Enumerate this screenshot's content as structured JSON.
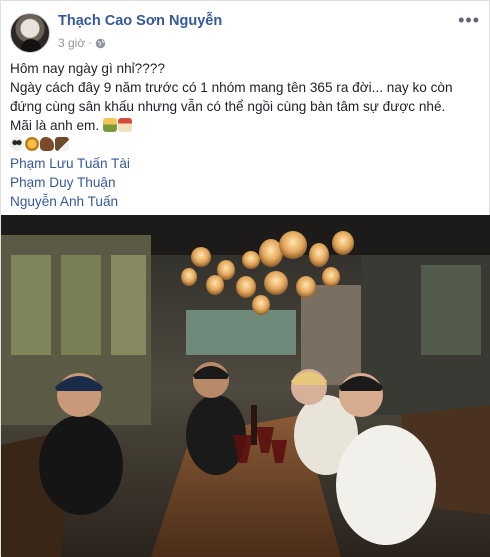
{
  "post": {
    "author": "Thạch Cao Sơn Nguyễn",
    "timestamp": "3 giờ",
    "separator": "·",
    "privacy_icon": "globe-icon",
    "more_label": "•••",
    "lines": [
      "Hôm nay ngày gì nhỉ????",
      "Ngày cách đây 9 năm trước có 1 nhóm mang tên 365 ra đời... nay ko còn",
      "đứng cùng sân khấu nhưng vẫn có thể ngồi cùng bàn tâm sự được nhé.",
      "Mãi là anh em."
    ],
    "emoji_line1_icons": [
      "people-icon",
      "house-icon"
    ],
    "emoji_line2_icons": [
      "panda-icon",
      "lion-icon",
      "horse-icon",
      "eagle-icon"
    ],
    "tags": [
      "Phạm Lưu Tuấn Tài",
      "Phạm Duy Thuận",
      "Nguyễn Anh Tuấn"
    ]
  }
}
